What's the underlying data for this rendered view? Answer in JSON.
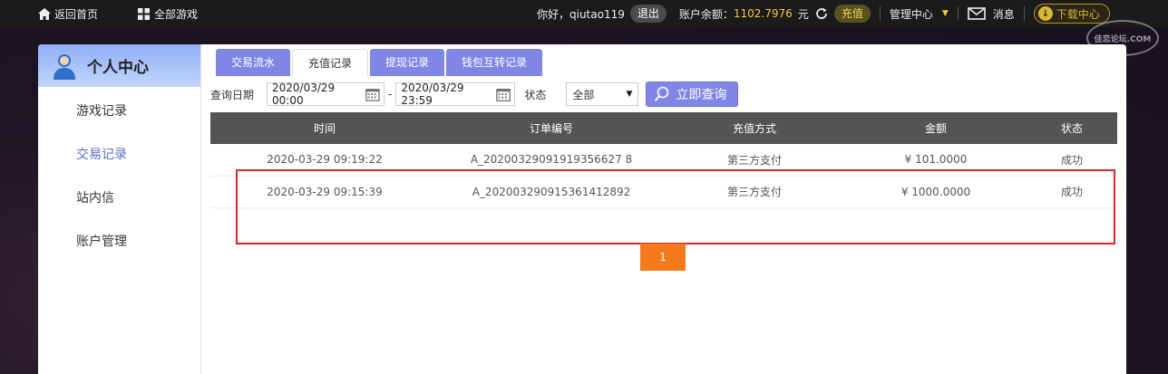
{
  "topbar": {
    "home": "返回首页",
    "all_games": "全部游戏",
    "greeting": "你好，qiutao119",
    "logout": "退出",
    "balance_label": "账户余额：",
    "balance_value": "1102.7976",
    "currency": "元",
    "recharge": "充值",
    "manage": "管理中心",
    "messages": "消息",
    "download": "下载中心",
    "watermark": "佳恋论坛.COM"
  },
  "sidebar": {
    "title": "个人中心",
    "items": [
      {
        "label": "游戏记录"
      },
      {
        "label": "交易记录"
      },
      {
        "label": "站内信"
      },
      {
        "label": "账户管理"
      }
    ]
  },
  "tabs": [
    {
      "label": "交易流水"
    },
    {
      "label": "充值记录"
    },
    {
      "label": "提现记录"
    },
    {
      "label": "钱包互转记录"
    }
  ],
  "query": {
    "date_label": "查询日期",
    "start": "2020/03/29 00:00",
    "dash": "-",
    "end": "2020/03/29 23:59",
    "status_label": "状态",
    "status_value": "全部",
    "button": "立即查询"
  },
  "table": {
    "headers": [
      "时间",
      "订单编号",
      "充值方式",
      "金额",
      "状态"
    ],
    "rows": [
      [
        "2020-03-29 09:19:22",
        "A_20200329091919356627 8",
        "第三方支付",
        "¥ 101.0000",
        "成功"
      ],
      [
        "2020-03-29 09:15:39",
        "A_202003290915361412892",
        "第三方支付",
        "¥ 1000.0000",
        "成功"
      ]
    ]
  },
  "pager": {
    "page": "1"
  },
  "colors": {
    "accent": "#7f86e6",
    "pager": "#f47a1c",
    "highlight": "#e0242b"
  }
}
